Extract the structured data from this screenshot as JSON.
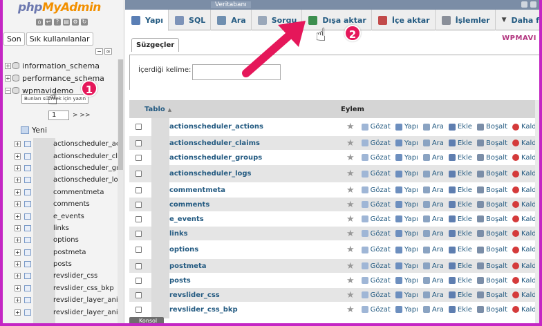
{
  "app": {
    "logo_php": "php",
    "logo_my": "MyAdmin"
  },
  "nav_tabs": {
    "recent": "Son",
    "favorites": "Sık kullanılanlar"
  },
  "databases": [
    {
      "name": "information_schema"
    },
    {
      "name": "performance_schema"
    },
    {
      "name": "wpmavidemo_"
    }
  ],
  "tooltip": "Bunları süzmek için yazın",
  "pagination": {
    "page": "1",
    "next": "> >>"
  },
  "new_label": "Yeni",
  "sidebar_tables": [
    {
      "name": "actionscheduler_actio"
    },
    {
      "name": "actionscheduler_cla"
    },
    {
      "name": "actionscheduler_gro"
    },
    {
      "name": "actionscheduler_log"
    },
    {
      "name": "commentmeta"
    },
    {
      "name": "comments"
    },
    {
      "name": "e_events"
    },
    {
      "name": "links"
    },
    {
      "name": "options"
    },
    {
      "name": "postmeta"
    },
    {
      "name": "posts"
    },
    {
      "name": "revslider_css"
    },
    {
      "name": "revslider_css_bkp"
    },
    {
      "name": "revslider_layer_anim"
    },
    {
      "name": "revslider_layer_anim"
    }
  ],
  "breadcrumb": "Veritabanı",
  "tabs": [
    {
      "label": "Yapı",
      "icon": "structure-icon",
      "color": "#5a7fb5"
    },
    {
      "label": "SQL",
      "icon": "sql-icon",
      "color": "#7d93b8"
    },
    {
      "label": "Ara",
      "icon": "search-icon",
      "color": "#6f8fb0"
    },
    {
      "label": "Sorgu",
      "icon": "query-icon",
      "color": "#9aa8ba"
    },
    {
      "label": "Dışa aktar",
      "icon": "export-icon",
      "color": "#3d8f4f"
    },
    {
      "label": "İçe aktar",
      "icon": "import-icon",
      "color": "#c24a4a"
    },
    {
      "label": "İşlemler",
      "icon": "operations-icon",
      "color": "#8a8f99"
    },
    {
      "label": "Daha fazla",
      "icon": "chevron-down-icon",
      "color": "#444444"
    }
  ],
  "filters": {
    "title": "Süzgeçler",
    "label": "İçerdiği kelime:",
    "value": ""
  },
  "brand": "WPMAVI",
  "table_header": {
    "table": "Tablo",
    "action": "Eylem"
  },
  "actions": {
    "browse": "Gözat",
    "structure": "Yapı",
    "search": "Ara",
    "insert": "Ekle",
    "empty": "Boşalt",
    "drop": "Kaldır"
  },
  "rows": [
    {
      "name": "actionscheduler_actions",
      "tall": true
    },
    {
      "name": "actionscheduler_claims",
      "tall": false
    },
    {
      "name": "actionscheduler_groups",
      "tall": false
    },
    {
      "name": "actionscheduler_logs",
      "tall": true
    },
    {
      "name": "commentmeta",
      "tall": false
    },
    {
      "name": "comments",
      "tall": false
    },
    {
      "name": "e_events",
      "tall": false
    },
    {
      "name": "links",
      "tall": false
    },
    {
      "name": "options",
      "tall": true
    },
    {
      "name": "postmeta",
      "tall": false
    },
    {
      "name": "posts",
      "tall": false
    },
    {
      "name": "revslider_css",
      "tall": false
    },
    {
      "name": "revslider_css_bkp",
      "tall": false
    }
  ],
  "console": "Konsol",
  "badges": {
    "one": "1",
    "two": "2"
  },
  "colors": {
    "accent": "#235a81",
    "badge": "#e5175a",
    "border": "#c426c4"
  }
}
